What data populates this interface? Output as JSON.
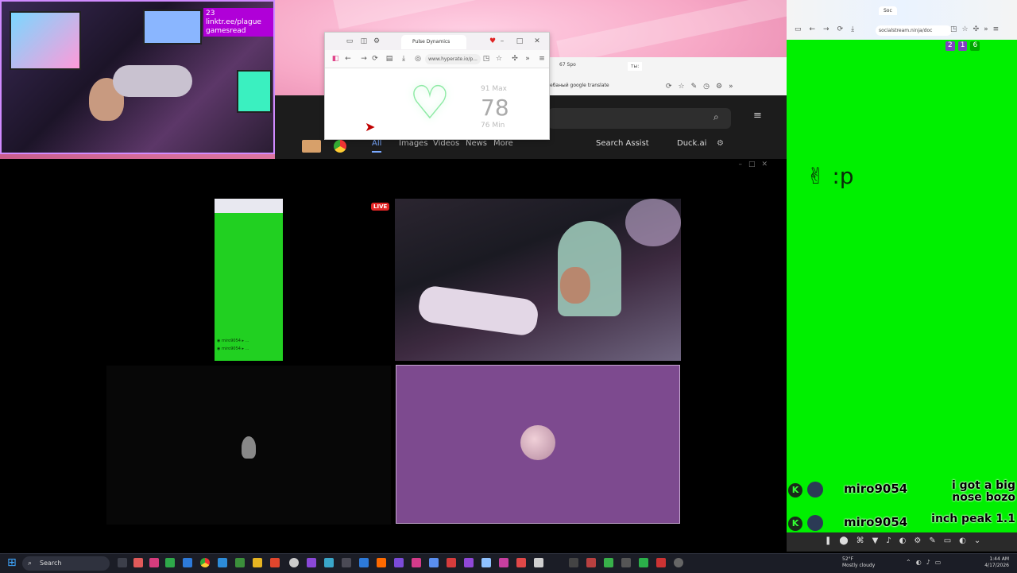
{
  "stream_overlay": {
    "url_text": "23 linktr.ee/plague gamesread",
    "live_badge": "LIVE"
  },
  "pulse_popup": {
    "tab_title": "Pulse Dynamics",
    "url": "www.hyperate.io/p...",
    "bpm": "78",
    "max_label": "91 Max",
    "min_label": "76 Min"
  },
  "browser_back": {
    "tab1": "67 Spo",
    "tab2": "ты:",
    "translate_tab": "ебаный google translate"
  },
  "duckduckgo": {
    "tabs": [
      "All",
      "Images",
      "Videos",
      "News",
      "More"
    ],
    "search_assist": "Search Assist",
    "duck_ai": "Duck.ai"
  },
  "right_browser": {
    "tab": "Soc",
    "url": "socialstream.ninja/doc",
    "badges": [
      "2",
      "1",
      "6"
    ]
  },
  "chat": [
    {
      "user": "miro9054",
      "message": "i got a big nose bozo"
    },
    {
      "user": "miro9054",
      "message": "inch peak 1.1"
    }
  ],
  "peace_text": "✌ :p",
  "taskbar": {
    "search_placeholder": "Search",
    "weather_temp": "52°F",
    "weather_desc": "Mostly cloudy",
    "time": "1:44 AM",
    "date": "4/17/2026"
  }
}
